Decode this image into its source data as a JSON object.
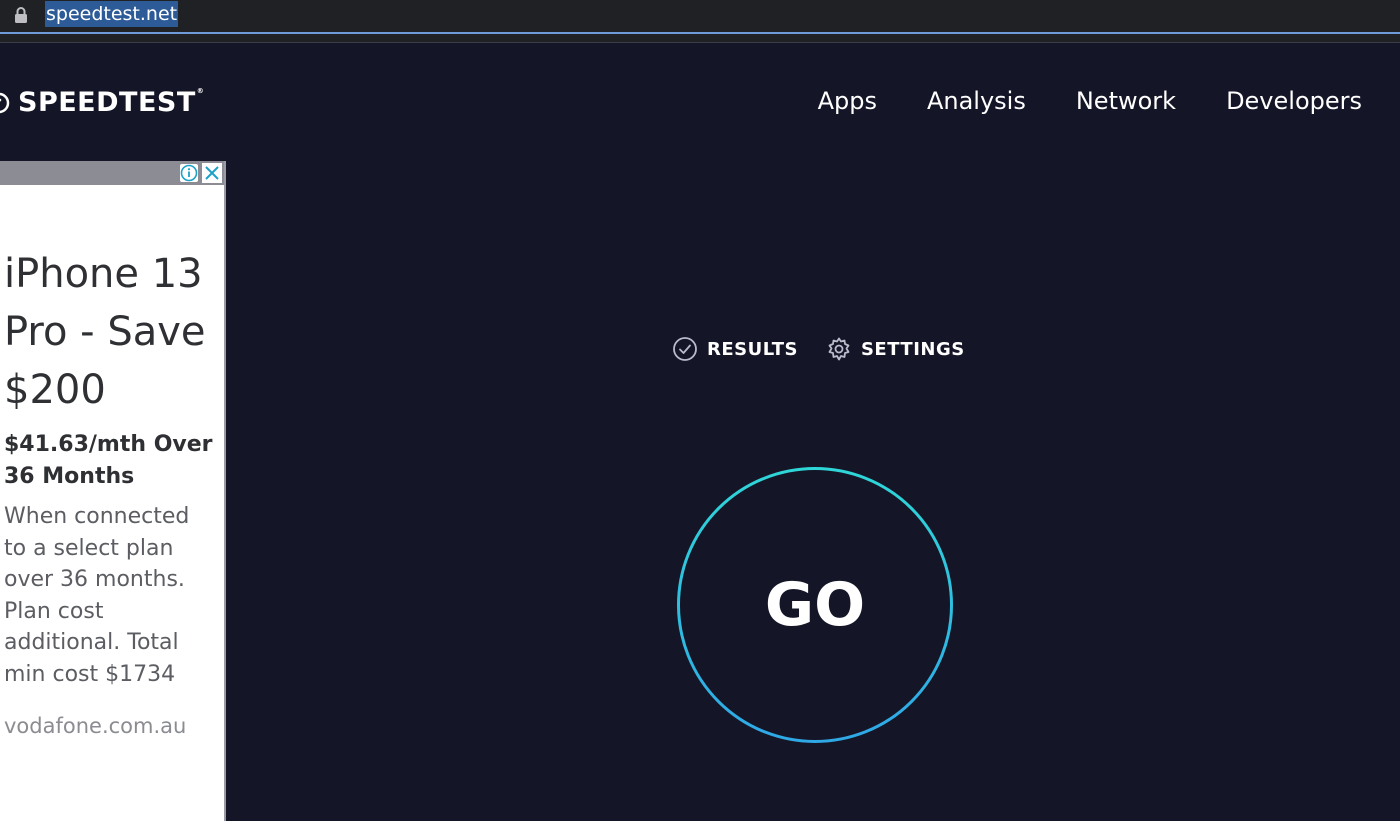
{
  "browser": {
    "url": "speedtest.net"
  },
  "header": {
    "logo_text": "SPEEDTEST",
    "logo_tm": "®",
    "nav": [
      {
        "label": "Apps"
      },
      {
        "label": "Analysis"
      },
      {
        "label": "Network"
      },
      {
        "label": "Developers"
      }
    ]
  },
  "ad": {
    "headline": "iPhone 13 Pro - Save $200",
    "price": "$41.63/mth Over 36 Months",
    "body": "When connected to a select plan over 36 months. Plan cost additional. Total min cost $1734",
    "domain": "vodafone.com.au"
  },
  "controls": {
    "results_label": "RESULTS",
    "settings_label": "SETTINGS"
  },
  "go": {
    "label": "GO"
  },
  "colors": {
    "background": "#141526",
    "go_ring_top": "#2fd6d8",
    "go_ring_bottom": "#2fa8e6",
    "url_highlight": "#2d5b97"
  }
}
